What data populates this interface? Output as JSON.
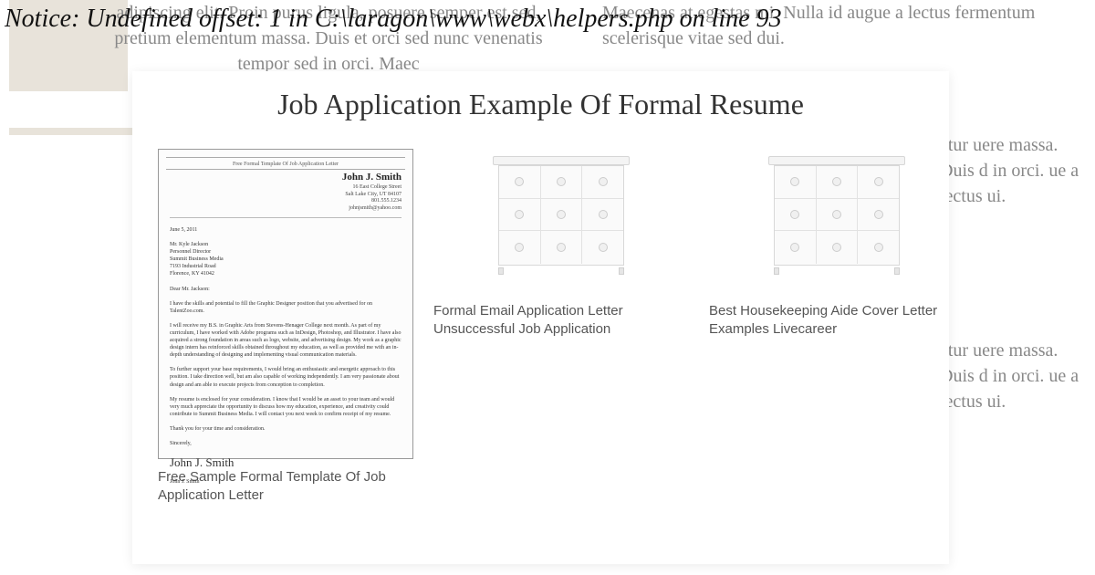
{
  "error_notice": "Notice: Undefined offset: 1 in C:\\laragon\\www\\webx\\helpers.php on line 93",
  "bg": {
    "text1": "adipiscing elit. Proin purus ligula, posuere semper est sed, pretium elementum massa. Duis et orci sed nunc venenatis tempor sed in orci. Maec",
    "text2": "Maecenas at egestas mi. Nulla id augue a lectus fermentum scelerisque vitae sed dui.",
    "text3": "etur uere massa. Duis d in orci. ue a lectus ui.",
    "text4": "etur uere massa. Duis d in orci. ue a lectus ui."
  },
  "card": {
    "title": "Job Application Example Of Formal Resume"
  },
  "thumbs": [
    {
      "caption": "Free Sample Formal Template Of Job Application Letter",
      "letter": {
        "band_title": "Free Formal Template Of Job Application Letter",
        "name": "John J. Smith",
        "addr_lines": [
          "16 East College Street",
          "Salt Lake City, UT 84107",
          "801.555.1234",
          "johnjsmith@yahoo.com"
        ],
        "date": "June 5, 2011",
        "recipient_lines": [
          "Mr. Kyle Jackson",
          "Personnel Director",
          "Summit Business Media",
          "7193 Industrial Road",
          "Florence, KY 41042"
        ],
        "greeting": "Dear Mr. Jackson:",
        "paragraphs": [
          "I have the skills and potential to fill the Graphic Designer position that you advertised for on TalentZoo.com.",
          "I will receive my B.S. in Graphic Arts from Stevens-Henager College next month. As part of my curriculum, I have worked with Adobe programs such as InDesign, Photoshop, and Illustrator. I have also acquired a strong foundation in areas such as logo, website, and advertising design. My work as a graphic design intern has reinforced skills obtained throughout my education, as well as provided me with an in-depth understanding of designing and implementing visual communication materials.",
          "To further support your base requirements, I would bring an enthusiastic and energetic approach to this position. I take direction well, but am also capable of working independently. I am very passionate about design and am able to execute projects from conception to completion.",
          "My resume is enclosed for your consideration. I know that I would be an asset to your team and would very much appreciate the opportunity to discuss how my education, experience, and creativity could contribute to Summit Business Media. I will contact you next week to confirm receipt of my resume.",
          "Thank you for your time and consideration."
        ],
        "closing": "Sincerely,",
        "signature": "John J. Smith",
        "printed_name": "John J. Smith"
      }
    },
    {
      "caption": "Formal Email Application Letter Unsuccessful Job Application"
    },
    {
      "caption": "Best Housekeeping Aide Cover Letter Examples Livecareer"
    }
  ]
}
